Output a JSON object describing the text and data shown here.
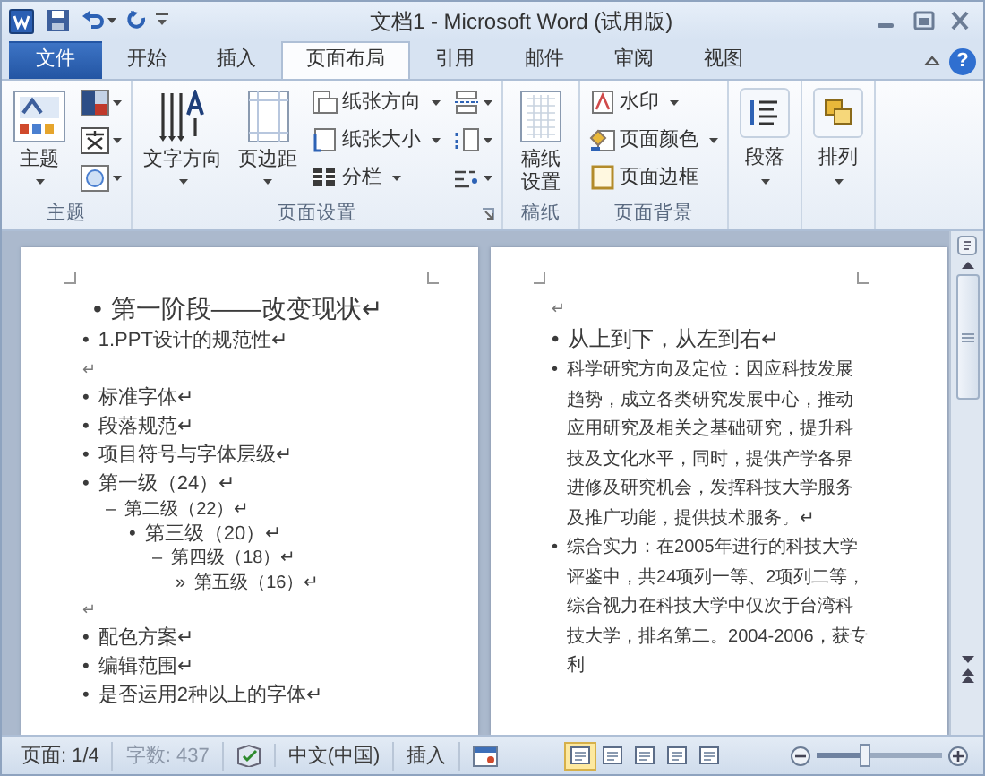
{
  "title_bar": {
    "title": "文档1 - Microsoft Word (试用版)"
  },
  "ribbon_tabs": [
    {
      "label": "文件",
      "kind": "file",
      "selected": false
    },
    {
      "label": "开始",
      "kind": "tab",
      "selected": false
    },
    {
      "label": "插入",
      "kind": "tab",
      "selected": false
    },
    {
      "label": "页面布局",
      "kind": "tab",
      "selected": true
    },
    {
      "label": "引用",
      "kind": "tab",
      "selected": false
    },
    {
      "label": "邮件",
      "kind": "tab",
      "selected": false
    },
    {
      "label": "审阅",
      "kind": "tab",
      "selected": false
    },
    {
      "label": "视图",
      "kind": "tab",
      "selected": false
    }
  ],
  "help_button": "?",
  "ribbon_groups": [
    {
      "label": "主题",
      "launcher": false,
      "columns": [
        [
          {
            "kind": "large",
            "label": "主题",
            "dropdown": true
          }
        ],
        [
          {
            "kind": "icon",
            "dropdown": true
          },
          {
            "kind": "icon",
            "dropdown": true
          },
          {
            "kind": "icon",
            "dropdown": true
          }
        ]
      ]
    },
    {
      "label": "页面设置",
      "launcher": true,
      "columns": [
        [
          {
            "kind": "large",
            "label": "文字方向",
            "dropdown": true
          }
        ],
        [
          {
            "kind": "large",
            "label": "页边距",
            "dropdown": true
          }
        ],
        [
          {
            "kind": "small",
            "label": "纸张方向",
            "dropdown": true
          },
          {
            "kind": "small",
            "label": "纸张大小",
            "dropdown": true
          },
          {
            "kind": "small",
            "label": "分栏",
            "dropdown": true
          }
        ],
        [
          {
            "kind": "icon",
            "dropdown": true
          },
          {
            "kind": "icon",
            "dropdown": true
          },
          {
            "kind": "icon",
            "dropdown": true
          }
        ]
      ]
    },
    {
      "label": "稿纸",
      "launcher": false,
      "columns": [
        [
          {
            "kind": "large",
            "label": "稿纸设置",
            "dropdown": false
          }
        ]
      ]
    },
    {
      "label": "页面背景",
      "launcher": false,
      "columns": [
        [
          {
            "kind": "small",
            "label": "水印",
            "dropdown": true
          },
          {
            "kind": "small",
            "label": "页面颜色",
            "dropdown": true
          },
          {
            "kind": "small",
            "label": "页面边框",
            "dropdown": false
          }
        ]
      ]
    },
    {
      "columns": [
        [
          {
            "kind": "framed",
            "label": "段落",
            "dropdown": true
          }
        ]
      ]
    },
    {
      "columns": [
        [
          {
            "kind": "framed",
            "label": "排列",
            "dropdown": true
          }
        ]
      ]
    }
  ],
  "pages": [
    {
      "lines": [
        {
          "kind": "heading",
          "bullet": "•",
          "text": "第一阶段——改变现状↵"
        },
        {
          "kind": "item",
          "bullet": "•",
          "text": "1.PPT设计的规范性↵"
        },
        {
          "kind": "mark",
          "text": "↵"
        },
        {
          "kind": "item",
          "bullet": "•",
          "text": "标准字体↵"
        },
        {
          "kind": "item",
          "bullet": "•",
          "text": "段落规范↵"
        },
        {
          "kind": "item",
          "bullet": "•",
          "text": "项目符号与字体层级↵"
        },
        {
          "kind": "item",
          "bullet": "•",
          "text": "第一级（24）↵",
          "children": [
            {
              "kind": "item",
              "bullet": "–",
              "text": "第二级（22）↵",
              "children": [
                {
                  "kind": "item",
                  "bullet": "•",
                  "text": "第三级（20）↵",
                  "children": [
                    {
                      "kind": "item",
                      "bullet": "–",
                      "text": "第四级（18）↵",
                      "children": [
                        {
                          "kind": "item",
                          "bullet": "»",
                          "text": "第五级（16）↵"
                        }
                      ]
                    }
                  ]
                }
              ]
            }
          ]
        },
        {
          "kind": "mark",
          "text": "↵"
        },
        {
          "kind": "item",
          "bullet": "•",
          "text": "配色方案↵"
        },
        {
          "kind": "item",
          "bullet": "•",
          "text": "编辑范围↵"
        },
        {
          "kind": "item",
          "bullet": "•",
          "text": "是否运用2种以上的字体↵"
        }
      ]
    },
    {
      "lines": [
        {
          "kind": "mark",
          "text": "↵"
        },
        {
          "kind": "lead",
          "bullet": "•",
          "text": "从上到下，从左到右↵"
        },
        {
          "kind": "item",
          "bullet": "•",
          "text": "科学研究方向及定位：因应科技发展趋势，成立各类研究发展中心，推动应用研究及相关之基础研究，提升科技及文化水平，同时，提供产学各界进修及研究机会，发挥科技大学服务及推广功能，提供技术服务。↵"
        },
        {
          "kind": "item",
          "bullet": "•",
          "text": "综合实力：在2005年进行的科技大学评鉴中，共24项列一等、2项列二等，综合视力在科技大学中仅次于台湾科技大学，排名第二。2004-2006，获专利"
        }
      ]
    }
  ],
  "status_bar": {
    "page": "页面: 1/4",
    "words": "字数: 437",
    "language": "中文(中国)",
    "mode": "插入",
    "view_buttons": [
      {
        "selected": true
      },
      {
        "selected": false
      },
      {
        "selected": false
      },
      {
        "selected": false
      },
      {
        "selected": false
      }
    ],
    "zoom_slider": {
      "level": 0.38
    }
  }
}
